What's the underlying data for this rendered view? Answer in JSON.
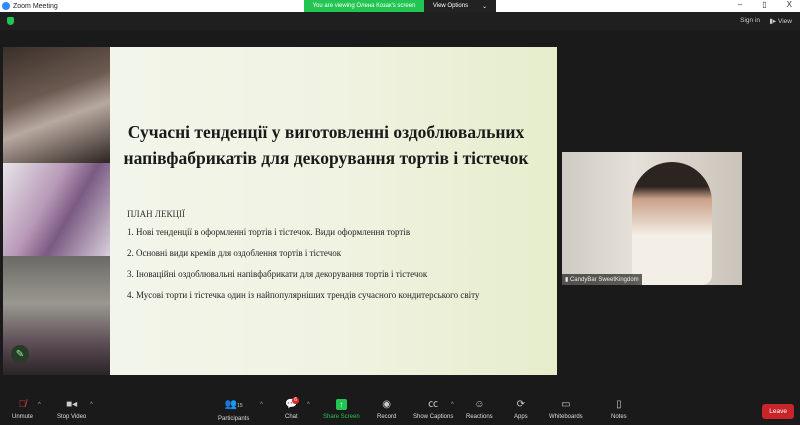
{
  "window": {
    "title": "Zoom Meeting",
    "banner": "You are viewing Олена Козак's screen",
    "view_options": "View Options",
    "minimize": "–",
    "restore": "▯",
    "close": "X"
  },
  "topbar": {
    "sign_in": "Sign in",
    "view": "View"
  },
  "slide": {
    "title": "Сучасні тенденції у виготовленні оздоблювальних напівфабрикатів для декорування тортів і тістечок",
    "plan_heading": "ПЛАН ЛЕКЦІЇ",
    "items": [
      "1. Нові тенденції в оформленні тортів і тістечок. Види оформлення тортів",
      "2. Основні види кремів для оздоблення тортів і тістечок",
      "3. Іноваційні оздоблювальні напівфабрикати для декорування тортів і тістечок",
      "4. Мусові торти і тістечка один із найпопулярніших трендів сучасного кондитерського світу"
    ]
  },
  "video": {
    "name": "CandyBar SweetKingdom"
  },
  "toolbar": {
    "unmute": "Unmute",
    "stop_video": "Stop Video",
    "participants": "Participants",
    "participants_count": "15",
    "chat": "Chat",
    "chat_badge": "6",
    "share_screen": "Share Screen",
    "record": "Record",
    "captions": "Show Captions",
    "reactions": "Reactions",
    "apps": "Apps",
    "whiteboards": "Whiteboards",
    "notes": "Notes",
    "leave": "Leave"
  }
}
